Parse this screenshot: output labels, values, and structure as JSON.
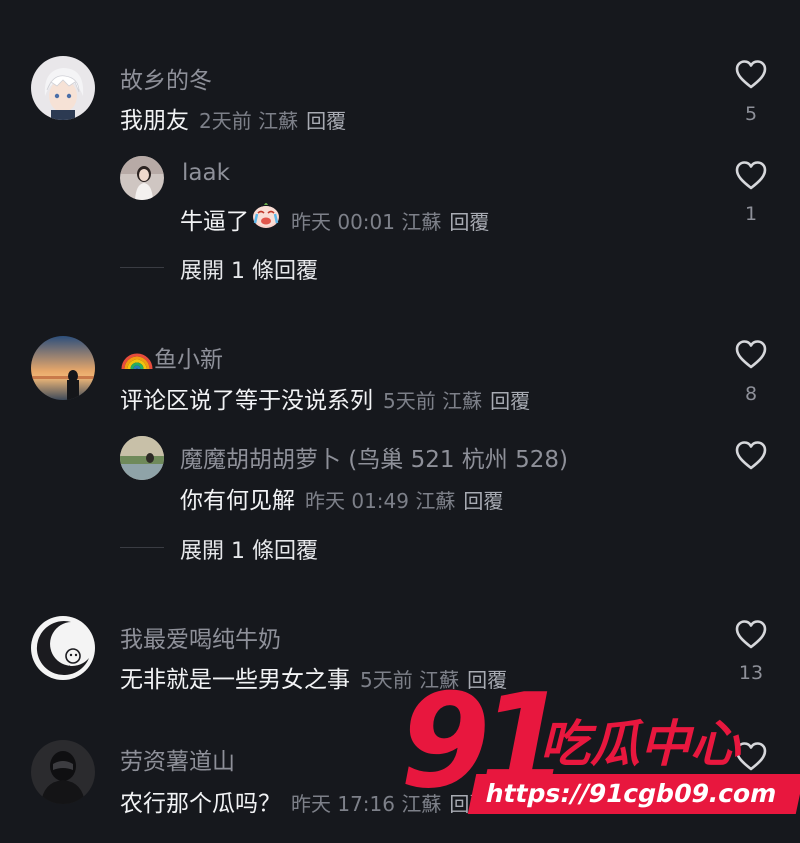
{
  "comments": [
    {
      "username": "故乡的冬",
      "text": "我朋友",
      "meta": "2天前 江蘇",
      "reply_label": "回覆",
      "likes": "5",
      "replies": [
        {
          "username": "laak",
          "text": "牛逼了",
          "emoji": "crying-face-emoji",
          "meta": "昨天 00:01 江蘇",
          "reply_label": "回覆",
          "likes": "1"
        }
      ],
      "expand_label": "展開 1 條回覆"
    },
    {
      "username": "鱼小新",
      "username_emoji": "rainbow-emoji",
      "text": "评论区说了等于没说系列",
      "meta": "5天前 江蘇",
      "reply_label": "回覆",
      "likes": "8",
      "replies": [
        {
          "username": "魔魔胡胡胡萝卜 (鸟巢 521 杭州 528)",
          "text": "你有何见解",
          "meta": "昨天 01:49 江蘇",
          "reply_label": "回覆",
          "likes": ""
        }
      ],
      "expand_label": "展開 1 條回覆"
    },
    {
      "username": "我最爱喝纯牛奶",
      "text": "无非就是一些男女之事",
      "meta": "5天前 江蘇",
      "reply_label": "回覆",
      "likes": "13"
    },
    {
      "username": "劳资薯道山",
      "text": "农行那个瓜吗？",
      "meta": "昨天 17:16 江蘇",
      "reply_label": "回覆",
      "likes": ""
    }
  ],
  "watermark": {
    "number": "91",
    "brand": "吃瓜中心",
    "url": "https://91cgb09.com",
    "color": "#e8173e"
  }
}
